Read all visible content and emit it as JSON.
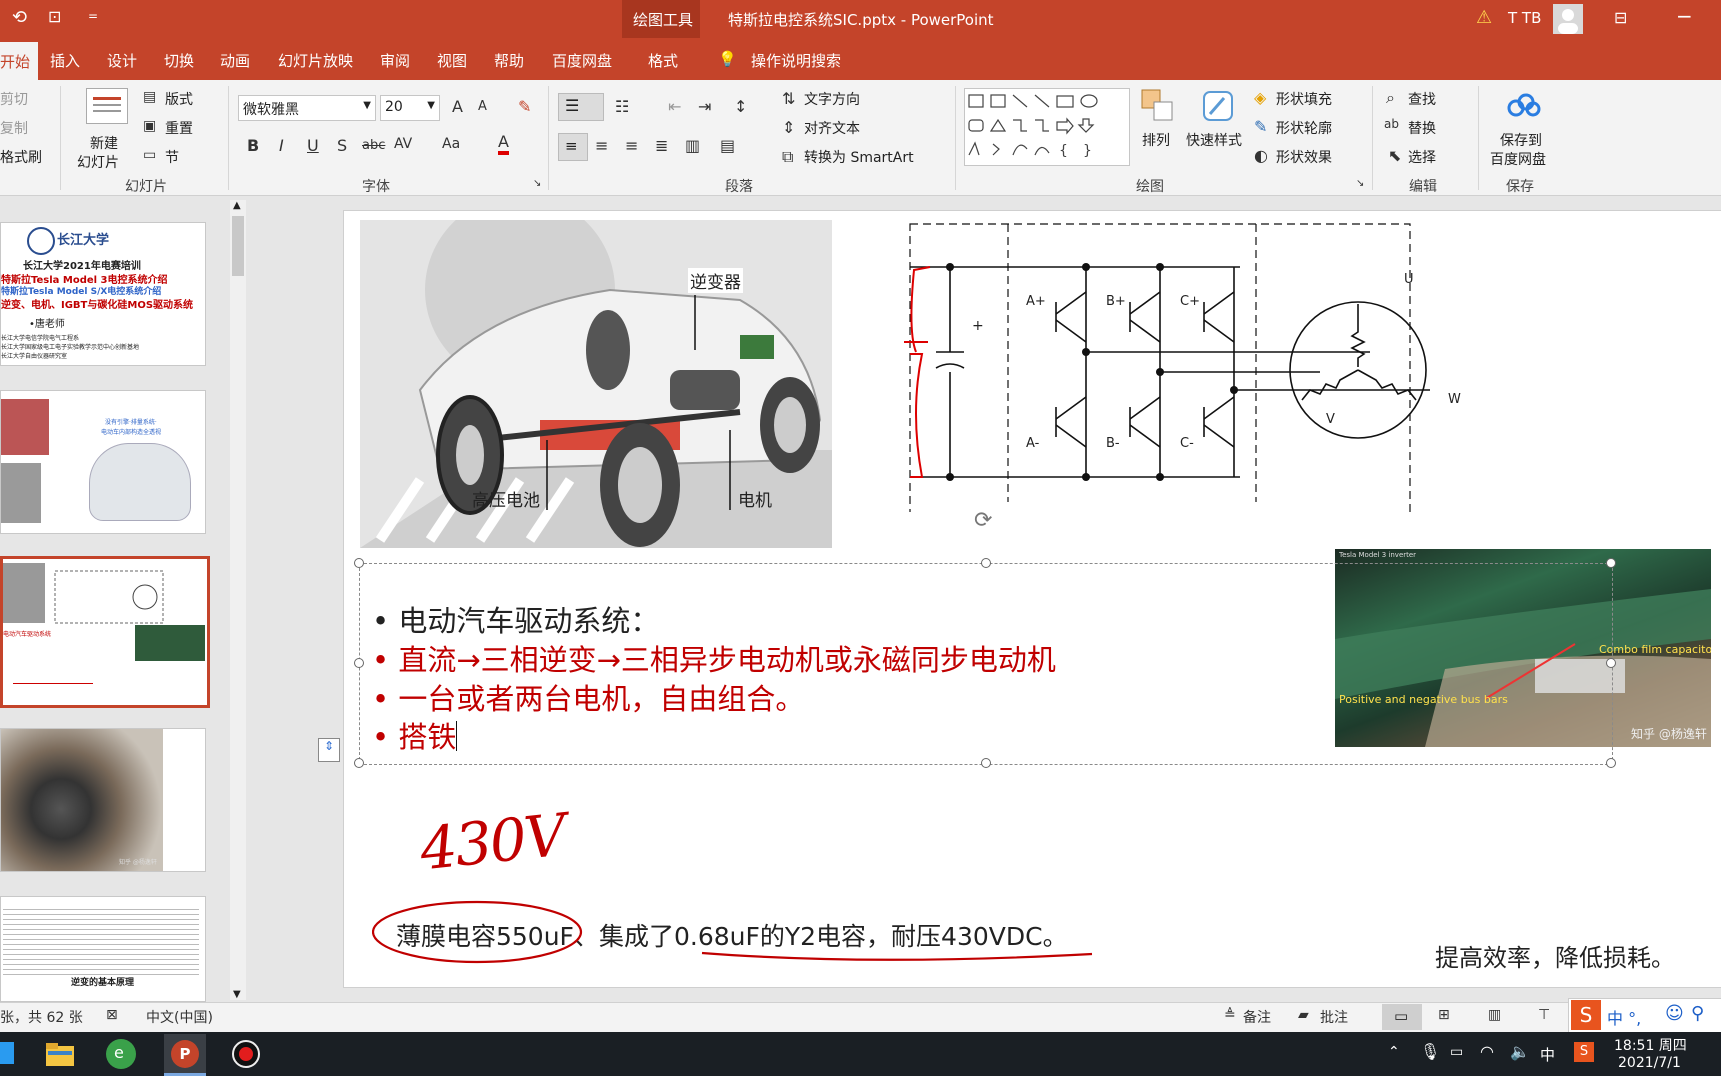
{
  "titlebar": {
    "context_tools": "绘图工具",
    "doc_title": "特斯拉电控系统SIC.pptx - PowerPoint",
    "user": "T TB",
    "quick_access_more": "="
  },
  "tabs": [
    {
      "label": "开始"
    },
    {
      "label": "插入"
    },
    {
      "label": "设计"
    },
    {
      "label": "切换"
    },
    {
      "label": "动画"
    },
    {
      "label": "幻灯片放映"
    },
    {
      "label": "审阅"
    },
    {
      "label": "视图"
    },
    {
      "label": "帮助"
    },
    {
      "label": "百度网盘"
    },
    {
      "label": "格式"
    }
  ],
  "tell_me": "操作说明搜索",
  "ribbon": {
    "clipboard": {
      "cut": "剪切",
      "copy": "复制",
      "format_painter": "格式刷"
    },
    "slides": {
      "new_slide_line1": "新建",
      "new_slide_line2": "幻灯片",
      "layout": "版式",
      "reset": "重置",
      "section": "节",
      "group": "幻灯片"
    },
    "font": {
      "name": "微软雅黑",
      "size": "20",
      "bold": "B",
      "italic": "I",
      "underline": "U",
      "shadow": "S",
      "strike": "abc",
      "spacing": "AV",
      "case": "Aa",
      "color": "A",
      "grow": "A",
      "shrink": "A",
      "group": "字体"
    },
    "paragraph": {
      "text_direction": "文字方向",
      "align_text": "对齐文本",
      "smartart": "转换为 SmartArt",
      "group": "段落"
    },
    "drawing": {
      "arrange": "排列",
      "quick_styles": "快速样式",
      "shape_fill": "形状填充",
      "shape_outline": "形状轮廓",
      "shape_effects": "形状效果",
      "group": "绘图"
    },
    "editing": {
      "find": "查找",
      "replace": "替换",
      "select": "选择",
      "group": "编辑"
    },
    "save": {
      "line1": "保存到",
      "line2": "百度网盘",
      "group": "保存"
    }
  },
  "thumbnails": [
    {
      "university": "长江大学",
      "title1": "长江大学2021年电赛培训",
      "title2": "特斯拉Tesla Model 3电控系统介绍",
      "title3": "特斯拉Tesla Model S/X电控系统介绍",
      "title4": "逆变、电机、IGBT与碳化硅MOS驱动系统",
      "author": "•唐老师",
      "affil1": "长江大学电信学院电气工程系",
      "affil2": "长江大学国家级电工电子实验教学示范中心创新基地",
      "affil3": "长江大学自由仪器研究室"
    },
    {
      "caption1": "没有引擎·排量系统·",
      "caption2": "电动车内部构造全透视"
    },
    {
      "label": "电动汽车驱动系统"
    },
    {
      "watermark": "知乎 @杨逸轩"
    },
    {
      "heading": "逆变的基本原理"
    }
  ],
  "slide": {
    "car_labels": {
      "inverter": "逆变器",
      "battery": "高压电池",
      "motor": "电机"
    },
    "circuit_labels": {
      "ap": "A+",
      "bp": "B+",
      "cp": "C+",
      "am": "A-",
      "bm": "B-",
      "cm": "C-",
      "u": "U",
      "v": "V",
      "w": "W",
      "plus": "+"
    },
    "photo_labels": {
      "combo": "Combo film capacitors",
      "busbar": "Positive and negative bus bars",
      "watermark": "知乎 @杨逸轩",
      "header": "Tesla Model 3 inverter"
    },
    "bullets": [
      {
        "text": "电动汽车驱动系统：",
        "color": "#222222"
      },
      {
        "text": "直流→三相逆变→三相异步电动机或永磁同步电动机",
        "color": "#c00000"
      },
      {
        "text": "一台或者两台电机，自由组合。",
        "color": "#c00000"
      },
      {
        "text": "搭铁",
        "color": "#c00000"
      }
    ],
    "handwriting": "430V",
    "caption_part1": "薄膜电容550uF",
    "caption_part2": "、集成了",
    "caption_part3": "0.68uF的Y2",
    "caption_part4": "电容，耐压430VDC。",
    "side_note": "提高效率，降低损耗。"
  },
  "status": {
    "slide_count": "张，共 62 张",
    "language": "中文(中国)",
    "notes": "备注",
    "comments": "批注"
  },
  "taskbar": {
    "time": "18:51 周四",
    "date": "2021/7/1",
    "ime": "中",
    "ime_bar": "中 °,"
  },
  "colors": {
    "accent": "#c4442a",
    "red_text": "#c00000",
    "taskbar": "#1a1f24"
  }
}
